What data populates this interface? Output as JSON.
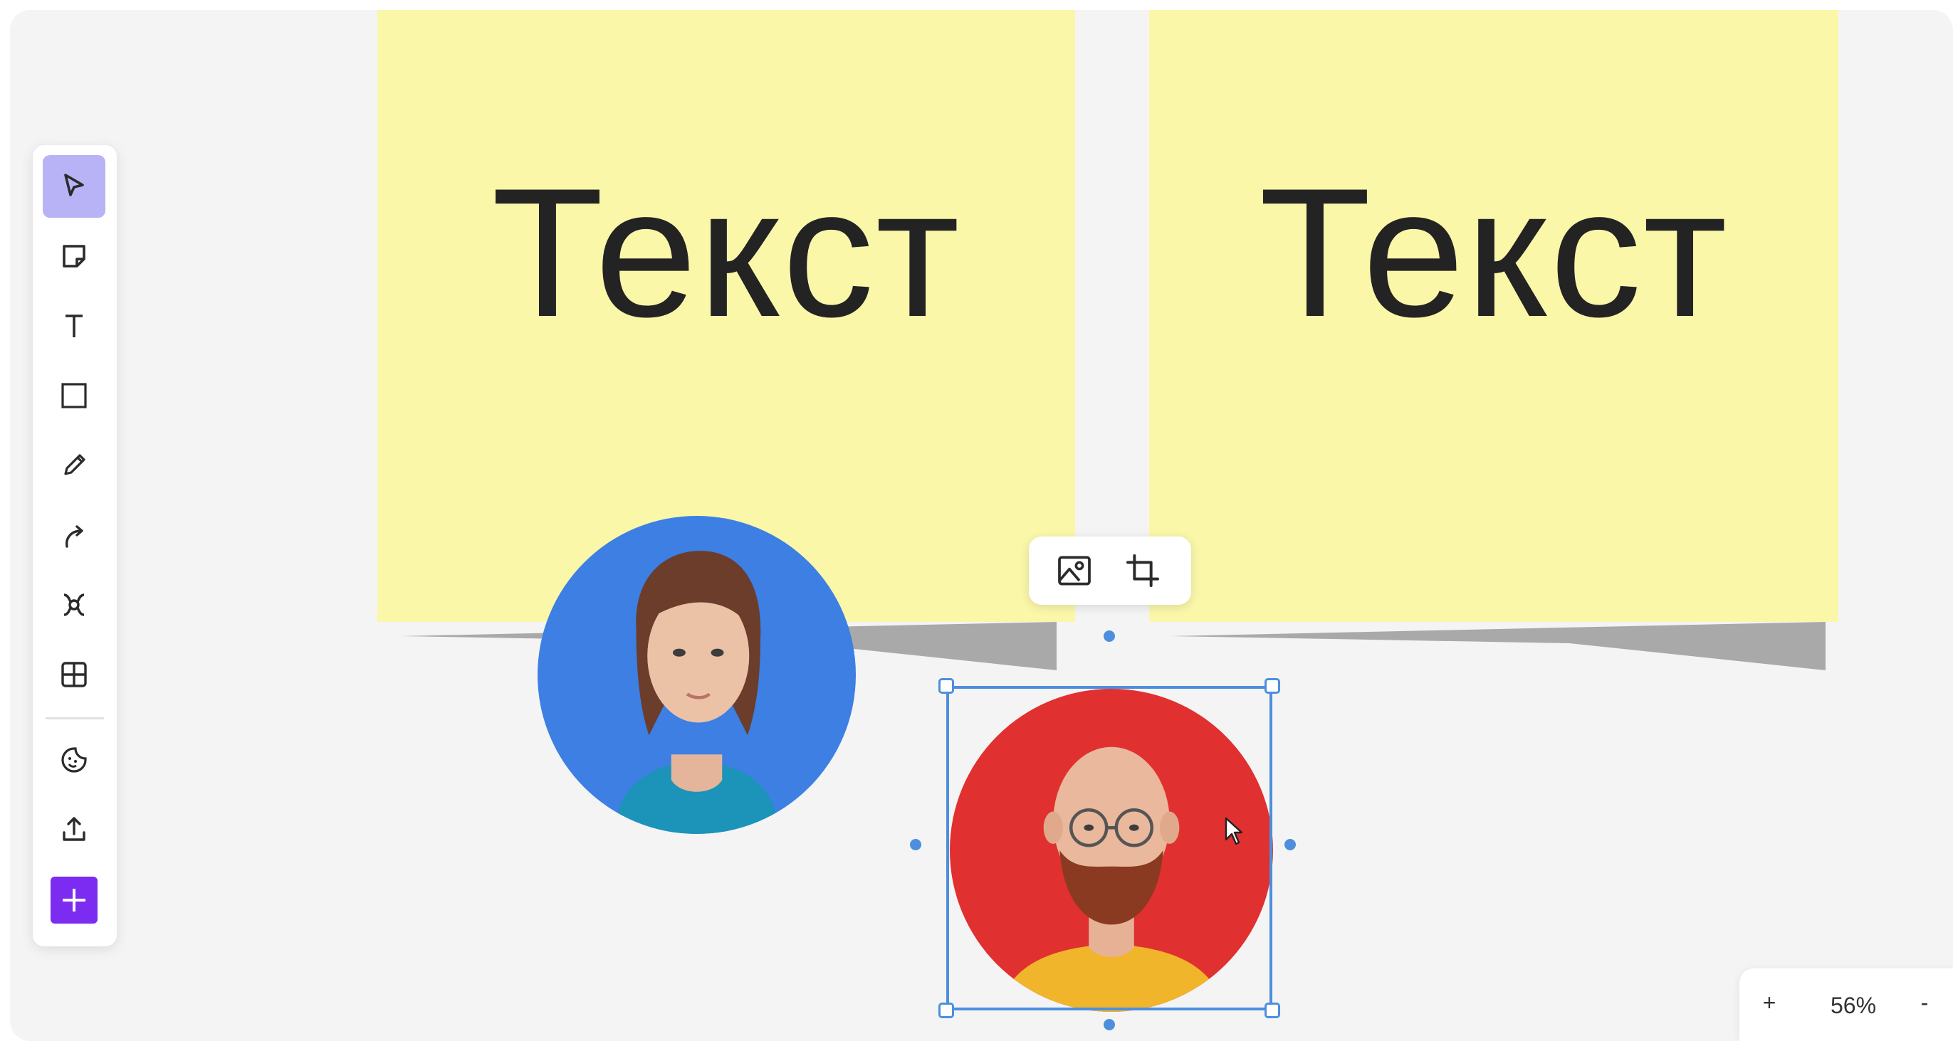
{
  "board": {
    "sticky_notes": [
      {
        "text": "Текст",
        "color": "#faf7a9"
      },
      {
        "text": "Текст",
        "color": "#faf7a9"
      }
    ]
  },
  "toolbar": {
    "tools": [
      {
        "name": "select",
        "icon": "cursor-arrow-icon",
        "active": true
      },
      {
        "name": "sticky-note",
        "icon": "sticky-note-icon"
      },
      {
        "name": "text",
        "icon": "text-icon"
      },
      {
        "name": "shape",
        "icon": "square-icon"
      },
      {
        "name": "pen",
        "icon": "pencil-icon"
      },
      {
        "name": "connector",
        "icon": "connector-arrow-icon"
      },
      {
        "name": "mind-map",
        "icon": "mind-map-icon"
      },
      {
        "name": "table",
        "icon": "table-icon"
      },
      {
        "name": "stickers",
        "icon": "sticker-icon"
      },
      {
        "name": "upload",
        "icon": "upload-icon"
      },
      {
        "name": "more",
        "icon": "plus-icon"
      }
    ],
    "active_color": "#b8b3f7",
    "add_color": "#7b2cf0"
  },
  "avatars": [
    {
      "description": "woman",
      "background": "#3d7fe3"
    },
    {
      "description": "bearded man with glasses",
      "background": "#e0302f",
      "selected": true
    }
  ],
  "image_toolbar": {
    "buttons": [
      {
        "name": "replace-image",
        "icon": "image-icon"
      },
      {
        "name": "crop",
        "icon": "crop-icon"
      }
    ]
  },
  "selection": {
    "color": "#4d8fdd"
  },
  "zoom": {
    "plus_label": "+",
    "level": "56%",
    "minus_label": "-"
  }
}
